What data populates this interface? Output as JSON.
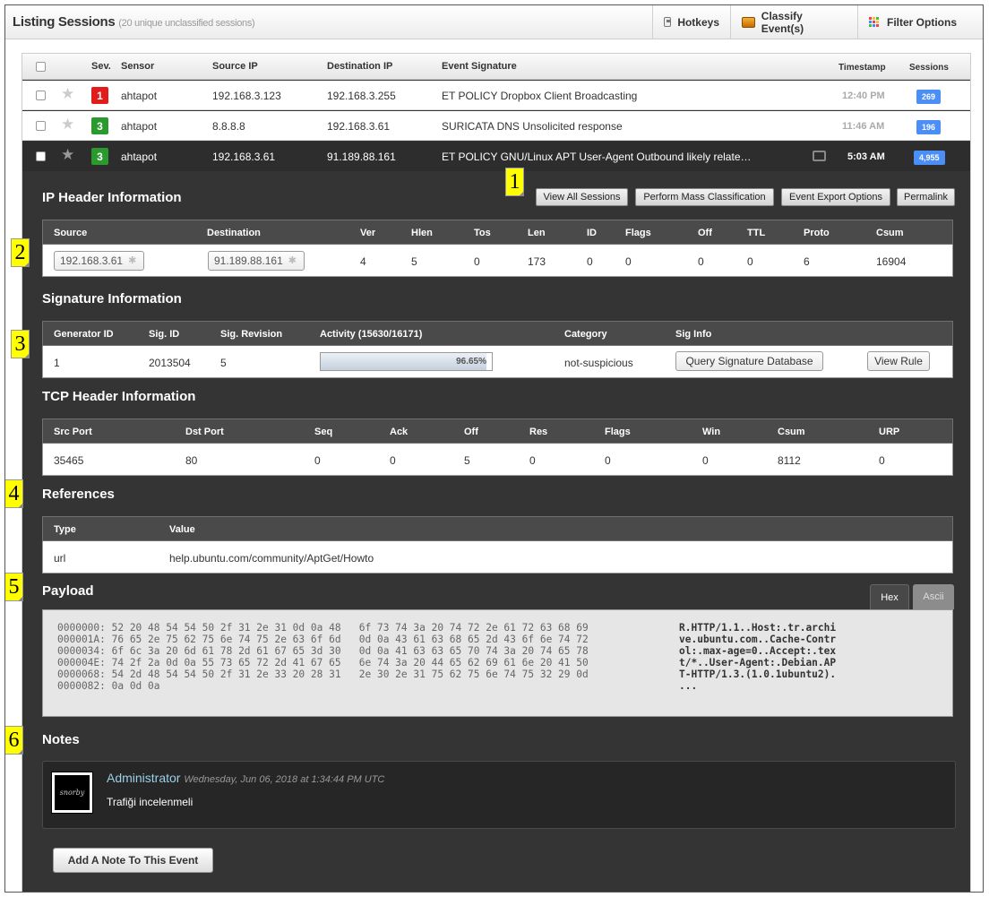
{
  "header": {
    "title": "Listing Sessions",
    "subtitle": "(20 unique unclassified sessions)",
    "buttons": {
      "hotkeys": "Hotkeys",
      "classify": "Classify Event(s)",
      "filter": "Filter Options"
    }
  },
  "list": {
    "columns": {
      "sev": "Sev.",
      "sensor": "Sensor",
      "source_ip": "Source IP",
      "destination_ip": "Destination IP",
      "signature": "Event Signature",
      "timestamp": "Timestamp",
      "sessions": "Sessions"
    },
    "rows": [
      {
        "sev": "1",
        "sensor": "ahtapot",
        "source_ip": "192.168.3.123",
        "destination_ip": "192.168.3.255",
        "signature": "ET POLICY Dropbox Client Broadcasting",
        "timestamp": "12:40 PM",
        "sessions": "269"
      },
      {
        "sev": "3",
        "sensor": "ahtapot",
        "source_ip": "8.8.8.8",
        "destination_ip": "192.168.3.61",
        "signature": "SURICATA DNS Unsolicited response",
        "timestamp": "11:46 AM",
        "sessions": "196"
      },
      {
        "sev": "3",
        "sensor": "ahtapot",
        "source_ip": "192.168.3.61",
        "destination_ip": "91.189.88.161",
        "signature": "ET POLICY GNU/Linux APT User-Agent Outbound likely relate…",
        "timestamp": "5:03 AM",
        "sessions": "4,955"
      }
    ]
  },
  "actions": {
    "view_all": "View All Sessions",
    "mass_class": "Perform Mass Classification",
    "export": "Event Export Options",
    "permalink": "Permalink"
  },
  "ip_header": {
    "title": "IP Header Information",
    "cols": [
      "Source",
      "Destination",
      "Ver",
      "Hlen",
      "Tos",
      "Len",
      "ID",
      "Flags",
      "Off",
      "TTL",
      "Proto",
      "Csum"
    ],
    "values": [
      "192.168.3.61",
      "91.189.88.161",
      "4",
      "5",
      "0",
      "173",
      "0",
      "0",
      "0",
      "0",
      "6",
      "16904"
    ]
  },
  "signature": {
    "title": "Signature Information",
    "cols": [
      "Generator ID",
      "Sig. ID",
      "Sig. Revision",
      "Activity (15630/16171)",
      "Category",
      "Sig Info"
    ],
    "gen_id": "1",
    "sig_id": "2013504",
    "revision": "5",
    "activity_pct": 96.65,
    "activity_label": "96.65%",
    "category": "not-suspicious",
    "query_btn": "Query Signature Database",
    "rule_btn": "View Rule"
  },
  "tcp_header": {
    "title": "TCP Header Information",
    "cols": [
      "Src Port",
      "Dst Port",
      "Seq",
      "Ack",
      "Off",
      "Res",
      "Flags",
      "Win",
      "Csum",
      "URP"
    ],
    "values": [
      "35465",
      "80",
      "0",
      "0",
      "5",
      "0",
      "0",
      "0",
      "8112",
      "0"
    ]
  },
  "references": {
    "title": "References",
    "cols": [
      "Type",
      "Value"
    ],
    "type": "url",
    "value": "help.ubuntu.com/community/AptGet/Howto"
  },
  "payload": {
    "title": "Payload",
    "tab_hex": "Hex",
    "tab_ascii": "Ascii",
    "hex": "0000000: 52 20 48 54 54 50 2f 31 2e 31 0d 0a 48   6f 73 74 3a 20 74 72 2e 61 72 63 68 69\n000001A: 76 65 2e 75 62 75 6e 74 75 2e 63 6f 6d   0d 0a 43 61 63 68 65 2d 43 6f 6e 74 72\n0000034: 6f 6c 3a 20 6d 61 78 2d 61 67 65 3d 30   0d 0a 41 63 63 65 70 74 3a 20 74 65 78\n000004E: 74 2f 2a 0d 0a 55 73 65 72 2d 41 67 65   6e 74 3a 20 44 65 62 69 61 6e 20 41 50\n0000068: 54 2d 48 54 54 50 2f 31 2e 33 20 28 31   2e 30 2e 31 75 62 75 6e 74 75 32 29 0d\n0000082: 0a 0d 0a",
    "ascii": "R.HTTP/1.1..Host:.tr.archi\nve.ubuntu.com..Cache-Contr\nol:.max-age=0..Accept:.tex\nt/*..User-Agent:.Debian.AP\nT-HTTP/1.3.(1.0.1ubuntu2).\n..."
  },
  "notes": {
    "title": "Notes",
    "author": "Administrator",
    "date": "Wednesday, Jun 06, 2018 at 1:34:44 PM UTC",
    "text": "Trafiği incelenmeli",
    "avatar_text": "snorby",
    "add_btn": "Add A Note To This Event"
  },
  "callouts": [
    "1",
    "2",
    "3",
    "4",
    "5",
    "6"
  ],
  "colors": {
    "sev_high": "#e21b1b",
    "sev_low": "#2b9a2e",
    "sessions_badge": "#4b8ef5",
    "callout": "#ffff00",
    "panel_bg": "#343434"
  }
}
